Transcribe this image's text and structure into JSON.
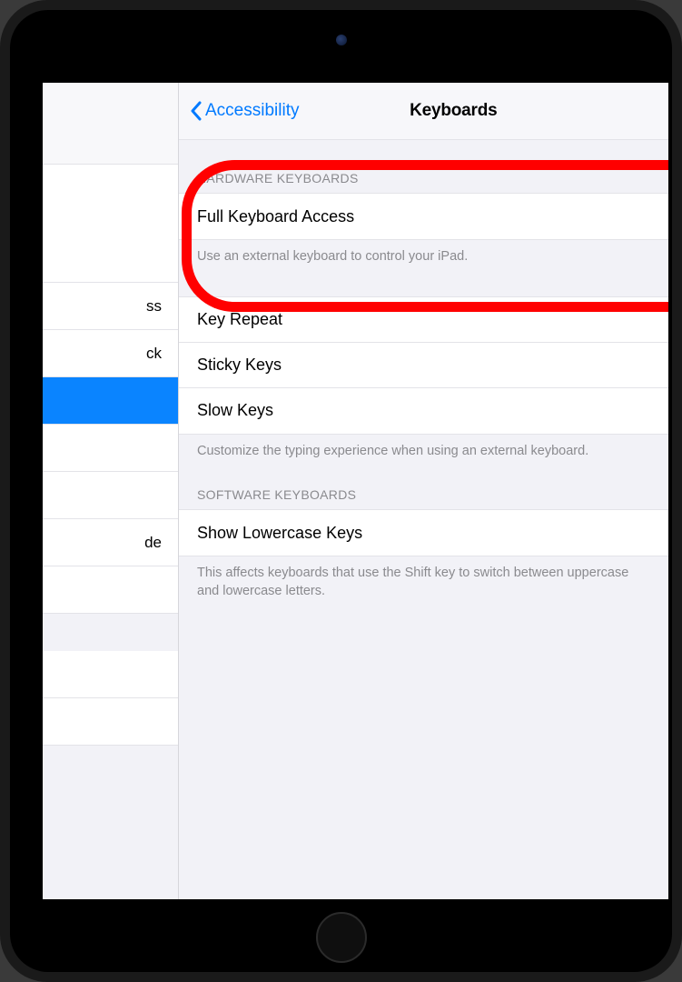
{
  "navbar": {
    "back_label": "Accessibility",
    "title": "Keyboards"
  },
  "hardware": {
    "header": "HARDWARE KEYBOARDS",
    "full_keyboard_access": "Full Keyboard Access",
    "full_keyboard_footer": "Use an external keyboard to control your iPad.",
    "key_repeat": "Key Repeat",
    "sticky_keys": "Sticky Keys",
    "slow_keys": "Slow Keys",
    "typing_footer": "Customize the typing experience when using an external keyboard."
  },
  "software": {
    "header": "SOFTWARE KEYBOARDS",
    "show_lowercase": "Show Lowercase Keys",
    "footer": "This affects keyboards that use the Shift key to switch between uppercase and lowercase letters."
  },
  "sidebar": {
    "items": [
      "ss",
      "ck",
      "",
      "",
      "",
      "de",
      "",
      ""
    ]
  }
}
